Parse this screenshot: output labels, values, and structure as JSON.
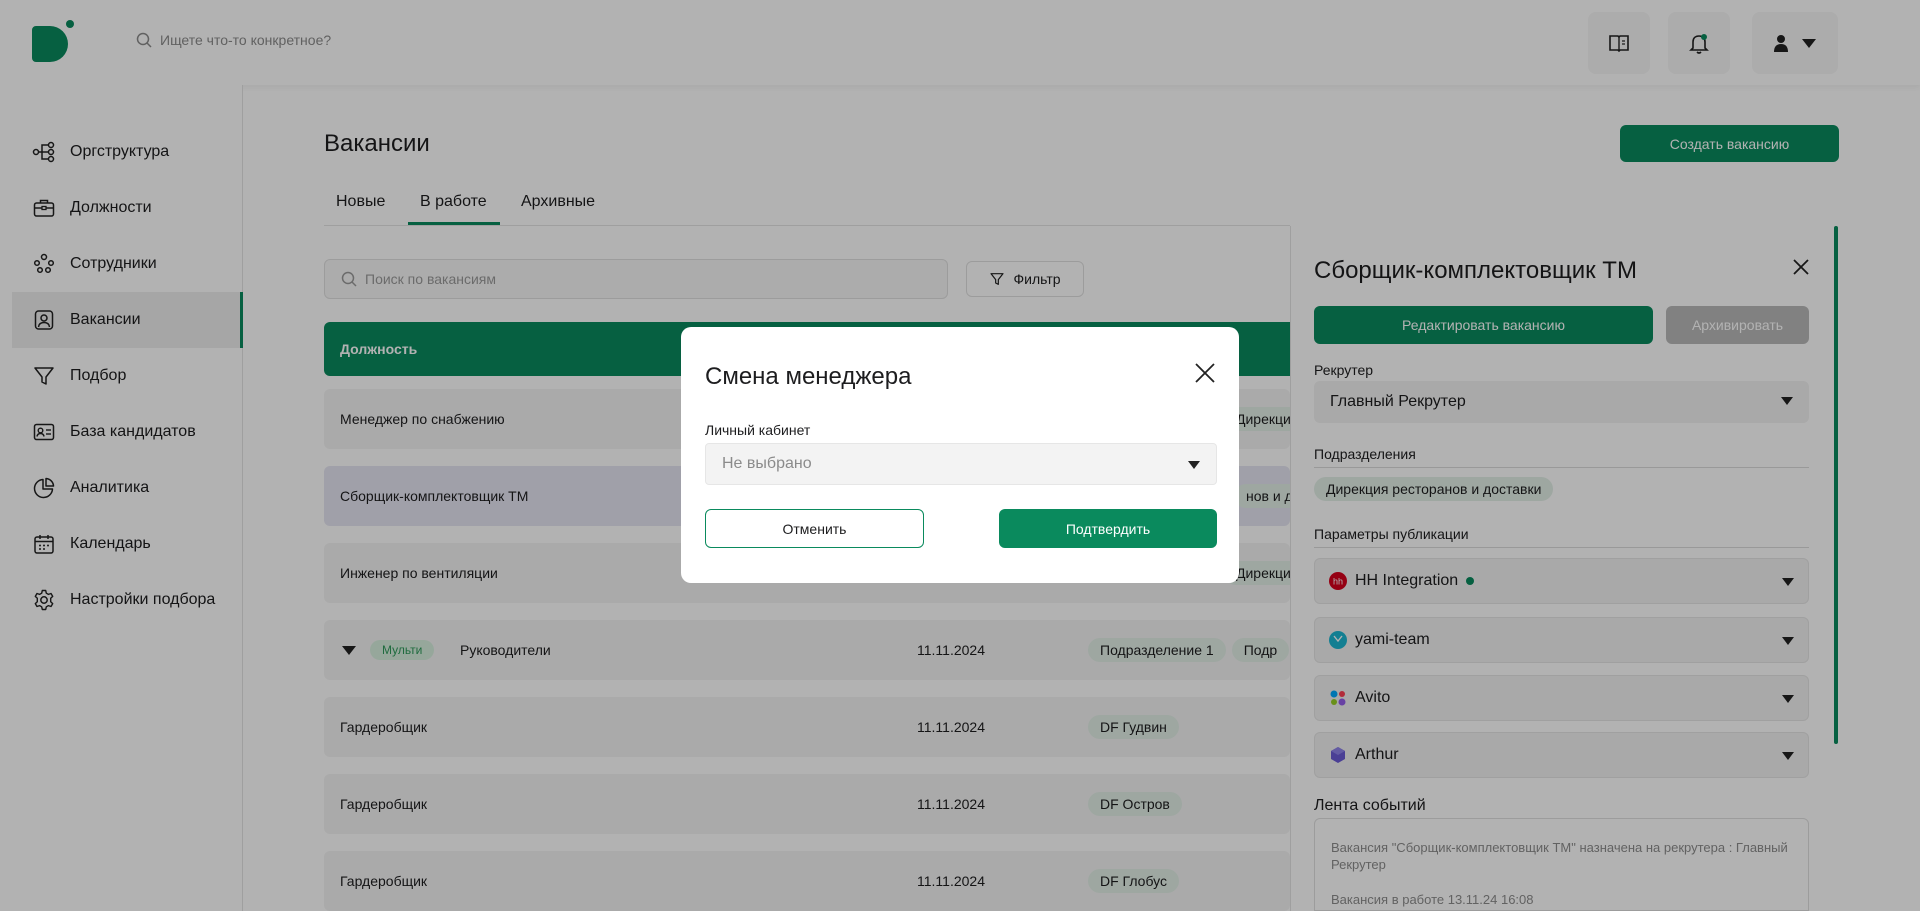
{
  "header": {
    "search_placeholder": "Ищете что-то конкретное?"
  },
  "sidebar": {
    "items": [
      {
        "label": "Оргструктура"
      },
      {
        "label": "Должности"
      },
      {
        "label": "Сотрудники"
      },
      {
        "label": "Вакансии",
        "active": true
      },
      {
        "label": "Подбор"
      },
      {
        "label": "База кандидатов"
      },
      {
        "label": "Аналитика"
      },
      {
        "label": "Календарь"
      },
      {
        "label": "Настройки подбора"
      }
    ]
  },
  "page": {
    "title": "Вакансии",
    "create_label": "Создать вакансию",
    "tabs": [
      {
        "label": "Новые"
      },
      {
        "label": "В работе",
        "active": true
      },
      {
        "label": "Архивные"
      }
    ],
    "search_placeholder": "Поиск по вакансиям",
    "filter_label": "Фильтр",
    "table_header": "Должность",
    "rows": [
      {
        "title": "Менеджер по снабжению",
        "date": "",
        "tags": [
          "Дирекция"
        ]
      },
      {
        "title": "Сборщик-комплектовщик ТМ",
        "date": "",
        "tags": [
          "нов и до"
        ],
        "selected": true
      },
      {
        "title": "Инженер по вентиляции",
        "date": "",
        "tags": [
          "Дирекция"
        ]
      },
      {
        "title": "Руководители",
        "date": "11.11.2024",
        "tags": [
          "Подразделение 1",
          "Подр"
        ],
        "multi": "Мульти"
      },
      {
        "title": "Гардеробщик",
        "date": "11.11.2024",
        "tags": [
          "DF Гудвин"
        ]
      },
      {
        "title": "Гардеробщик",
        "date": "11.11.2024",
        "tags": [
          "DF Остров"
        ]
      },
      {
        "title": "Гардеробщик",
        "date": "11.11.2024",
        "tags": [
          "DF Глобус"
        ]
      }
    ]
  },
  "panel": {
    "title": "Сборщик-комплектовщик ТМ",
    "edit_label": "Редактировать вакансию",
    "archive_label": "Архивировать",
    "recruiter_label": "Рекрутер",
    "recruiter_value": "Главный Рекрутер",
    "divisions_label": "Подразделения",
    "division_tag": "Дирекция ресторанов и доставки",
    "publication_label": "Параметры публикации",
    "publications": [
      {
        "name": "HH Integration",
        "icon": "hh-icon"
      },
      {
        "name": "yami-team",
        "icon": "yami-icon"
      },
      {
        "name": "Avito",
        "icon": "avito-icon"
      },
      {
        "name": "Arthur",
        "icon": "arthur-icon"
      }
    ],
    "events_label": "Лента событий",
    "events": [
      "Вакансия \"Сборщик-комплектовщик ТМ\" назначена на рекрутера : Главный Рекрутер",
      "Вакансия в работе 13.11.24 16:08"
    ]
  },
  "modal": {
    "title": "Смена менеджера",
    "field_label": "Личный кабинет",
    "field_placeholder": "Не выбрано",
    "cancel_label": "Отменить",
    "confirm_label": "Подтвердить"
  },
  "colors": {
    "accent": "#0a8a5d",
    "overlay": "rgba(0,0,0,0.30)"
  }
}
